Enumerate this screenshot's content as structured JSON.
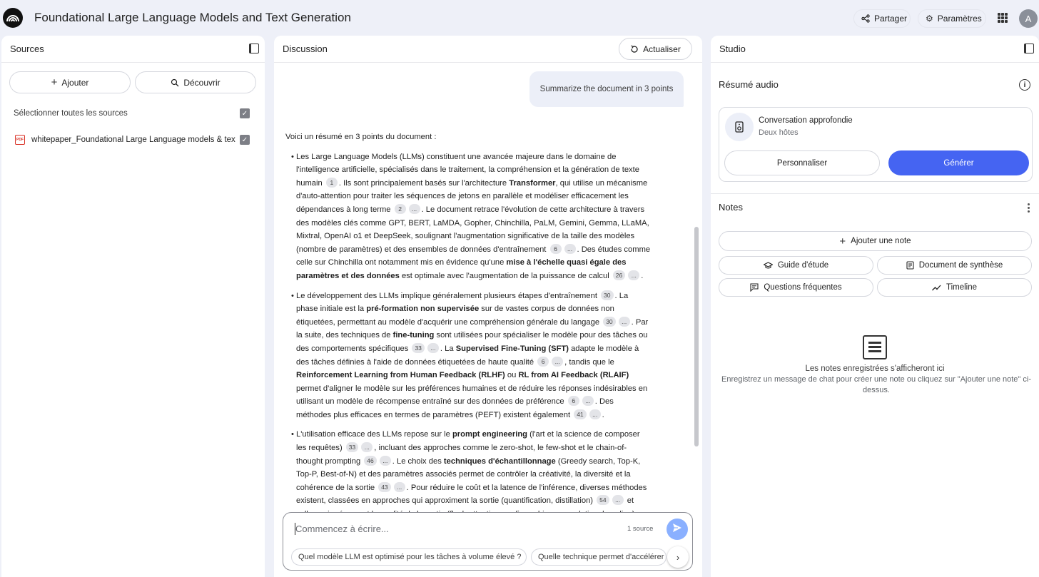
{
  "app": {
    "title": "Foundational Large Language Models and Text Generation",
    "share_label": "Partager",
    "settings_label": "Paramètres",
    "avatar_initial": "A"
  },
  "sources": {
    "title": "Sources",
    "add_label": "Ajouter",
    "discover_label": "Découvrir",
    "select_all_label": "Sélectionner toutes les sources",
    "items": [
      {
        "label": "whitepaper_Foundational Large Language models & text...",
        "icon": "pdf-icon",
        "checked": true
      }
    ]
  },
  "discussion": {
    "title": "Discussion",
    "refresh_label": "Actualiser",
    "user_message": "Summarize the document in 3 points",
    "intro": "Voici un résumé en 3 points du document :",
    "composer_placeholder": "Commencez à écrire...",
    "source_count": "1 source",
    "suggestions": [
      "Quel modèle LLM est optimisé pour les tâches à volume élevé ?",
      "Quelle technique permet d'accélérer"
    ]
  },
  "studio": {
    "title": "Studio",
    "audio_title": "Résumé audio",
    "audio_card_name": "Conversation approfondie",
    "audio_card_sub": "Deux hôtes",
    "customize_label": "Personnaliser",
    "generate_label": "Générer",
    "notes_title": "Notes",
    "add_note_label": "Ajouter une note",
    "study_guide_label": "Guide d'étude",
    "briefing_label": "Document de synthèse",
    "faq_label": "Questions fréquentes",
    "timeline_label": "Timeline",
    "empty_title": "Les notes enregistrées s'afficheront ici",
    "empty_text": "Enregistrez un message de chat pour créer une note ou cliquez sur \"Ajouter une note\" ci-dessus."
  },
  "colors": {
    "accent": "#4564f2",
    "background": "#eef0f8",
    "send_button": "#8ab0ff"
  }
}
